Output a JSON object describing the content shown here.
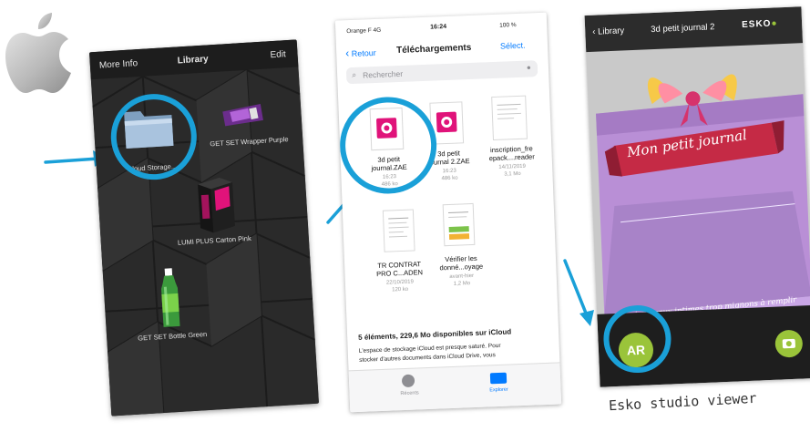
{
  "logo": {
    "icon": "apple-logo-icon"
  },
  "library": {
    "more_info": "More Info",
    "title": "Library",
    "edit": "Edit",
    "items": [
      {
        "label": "Cloud Storage...",
        "icon": "folder-icon"
      },
      {
        "label": "GET SET Wrapper Purple",
        "icon": "wrapper-package-icon"
      },
      {
        "label": "LUMI PLUS Carton Pink",
        "icon": "carton-box-icon"
      },
      {
        "label": "GET SET Bottle Green",
        "icon": "bottle-icon"
      }
    ]
  },
  "files": {
    "status": {
      "carrier": "Orange F  4G",
      "time": "16:24",
      "battery": "100 %"
    },
    "back": "Retour",
    "title": "Téléchargements",
    "select": "Sélect.",
    "search_placeholder": "Rechercher",
    "items": [
      {
        "name1": "3d petit",
        "name2": "journal.ZAE",
        "date": "16:23",
        "size": "486 ko"
      },
      {
        "name1": "3d petit",
        "name2": "journal 2.ZAE",
        "date": "16:23",
        "size": "486 ko"
      },
      {
        "name1": "inscription_fre",
        "name2": "epack....reader",
        "date": "14/11/2019",
        "size": "3,1 Mo"
      },
      {
        "name1": "TR  CONTRAT",
        "name2": "PRO C...ADEN",
        "date": "22/10/2019",
        "size": "120 ko"
      },
      {
        "name1": "Vérifier les",
        "name2": "donné...oyage",
        "date": "avant-hier",
        "size": "1,2 Mo"
      }
    ],
    "storage_title": "5 éléments, 229,6 Mo disponibles sur iCloud",
    "storage_text1": "L'espace de stockage iCloud est presque saturé. Pour",
    "storage_text2": "stocker d'autres documents dans iCloud Drive, vous",
    "tab_recent": "Récents",
    "tab_explore": "Explorer"
  },
  "viewer": {
    "back": "Library",
    "title": "3d petit journal 2",
    "brand": "ESKO",
    "banner": "Mon petit journal",
    "subtitle": "petits jeux...aux intimes trop mignons à remplir",
    "ar_button": "AR"
  },
  "caption": "Esko studio viewer",
  "colors": {
    "ring": "#1aa0d8",
    "zae_pink": "#e0137a",
    "purple": "#b98fd6",
    "ios_blue": "#007aff",
    "ar_green": "#9ac43a"
  }
}
